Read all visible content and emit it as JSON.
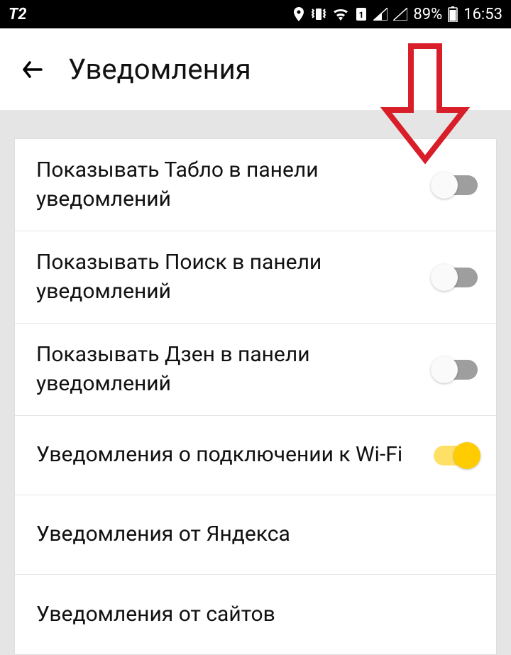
{
  "status": {
    "carrier": "T2",
    "battery_percent": "89%",
    "time": "16:53"
  },
  "header": {
    "title": "Уведомления"
  },
  "settings": [
    {
      "label": "Показывать Табло в панели уведомлений",
      "toggle": "off"
    },
    {
      "label": "Показывать Поиск в панели уведомлений",
      "toggle": "off"
    },
    {
      "label": "Показывать Дзен в панели уведомлений",
      "toggle": "off"
    },
    {
      "label": "Уведомления о подключении к Wi-Fi",
      "toggle": "on"
    },
    {
      "label": "Уведомления от Яндекса",
      "toggle": null
    },
    {
      "label": "Уведомления от сайтов",
      "toggle": null
    }
  ],
  "annotation": {
    "arrow_color": "#d81e28"
  }
}
